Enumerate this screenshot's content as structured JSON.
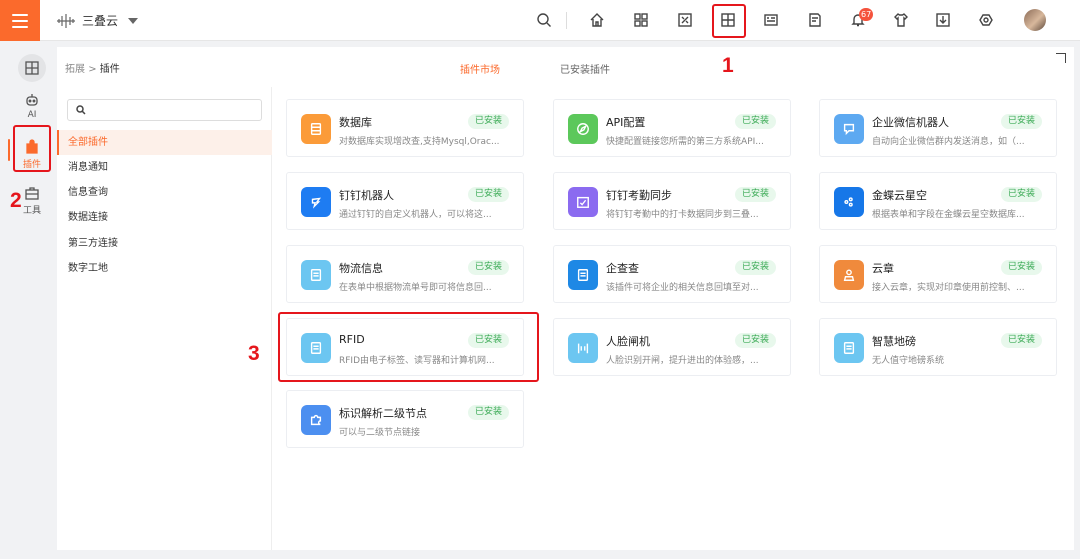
{
  "header": {
    "brand_name": "三叠云",
    "notification_count": "67",
    "icons": [
      "search-icon",
      "home-icon",
      "apps-icon",
      "screen-icon",
      "plugin-icon",
      "form-icon",
      "report-icon",
      "bell-icon",
      "shirt-icon",
      "download-icon",
      "settings-icon"
    ]
  },
  "rail": {
    "items": [
      {
        "label": "",
        "icon": "grid-icon"
      },
      {
        "label": "AI",
        "icon": "robot-icon"
      },
      {
        "label": "插件",
        "icon": "plugin-icon"
      },
      {
        "label": "工具",
        "icon": "toolbox-icon"
      }
    ]
  },
  "breadcrumb": {
    "parent": "拓展",
    "separator": ">",
    "current": "插件"
  },
  "tabs": [
    "插件市场",
    "已安装插件"
  ],
  "search": {
    "placeholder": ""
  },
  "categories": [
    "全部插件",
    "消息通知",
    "信息查询",
    "数据连接",
    "第三方连接",
    "数字工地"
  ],
  "plugins": [
    {
      "title": "数据库",
      "desc": "对数据库实现增改查,支持Mysql,Orac...",
      "badge": "已安装",
      "color": "#fb9b39",
      "icon": "database-icon"
    },
    {
      "title": "API配置",
      "desc": "快捷配置链接您所需的第三方系统API...",
      "badge": "已安装",
      "color": "#5cc85b",
      "icon": "compass-icon"
    },
    {
      "title": "企业微信机器人",
      "desc": "自动向企业微信群内发送消息，如（...",
      "badge": "已安装",
      "color": "#5da9f1",
      "icon": "chat-icon"
    },
    {
      "title": "钉钉机器人",
      "desc": "通过钉钉的自定义机器人，可以将这...",
      "badge": "已安装",
      "color": "#1e7cf2",
      "icon": "dingtalk-icon"
    },
    {
      "title": "钉钉考勤同步",
      "desc": "将钉钉考勤中的打卡数据同步到三叠...",
      "badge": "已安装",
      "color": "#8b6bf0",
      "icon": "calendar-check-icon"
    },
    {
      "title": "金蝶云星空",
      "desc": "根据表单和字段在金蝶云星空数据库...",
      "badge": "已安装",
      "color": "#1677e8",
      "icon": "kingdee-icon"
    },
    {
      "title": "物流信息",
      "desc": "在表单中根据物流单号即可将信息回...",
      "badge": "已安装",
      "color": "#6cc6f1",
      "icon": "document-icon"
    },
    {
      "title": "企查查",
      "desc": "该插件可将企业的相关信息回填至对...",
      "badge": "已安装",
      "color": "#1e88e5",
      "icon": "document-icon"
    },
    {
      "title": "云章",
      "desc": "接入云章，实现对印章使用前控制、...",
      "badge": "已安装",
      "color": "#f08a3c",
      "icon": "stamp-icon"
    },
    {
      "title": "RFID",
      "desc": "RFID由电子标签、读写器和计算机网...",
      "badge": "已安装",
      "color": "#6cc6f1",
      "icon": "document-icon"
    },
    {
      "title": "人脸闸机",
      "desc": "人脸识别开闸，提升进出的体验感，...",
      "badge": "已安装",
      "color": "#6cc6f1",
      "icon": "gate-icon"
    },
    {
      "title": "智慧地磅",
      "desc": "无人值守地磅系统",
      "badge": "已安装",
      "color": "#6cc6f1",
      "icon": "document-icon"
    },
    {
      "title": "标识解析二级节点",
      "desc": "可以与二级节点链接",
      "badge": "已安装",
      "color": "#4c8ff0",
      "icon": "puzzle-icon"
    }
  ],
  "annotations": [
    "1",
    "2",
    "3"
  ],
  "colors": {
    "accent": "#fb6a2c",
    "badge_text": "#3dab57",
    "annotation": "#e5161c"
  }
}
